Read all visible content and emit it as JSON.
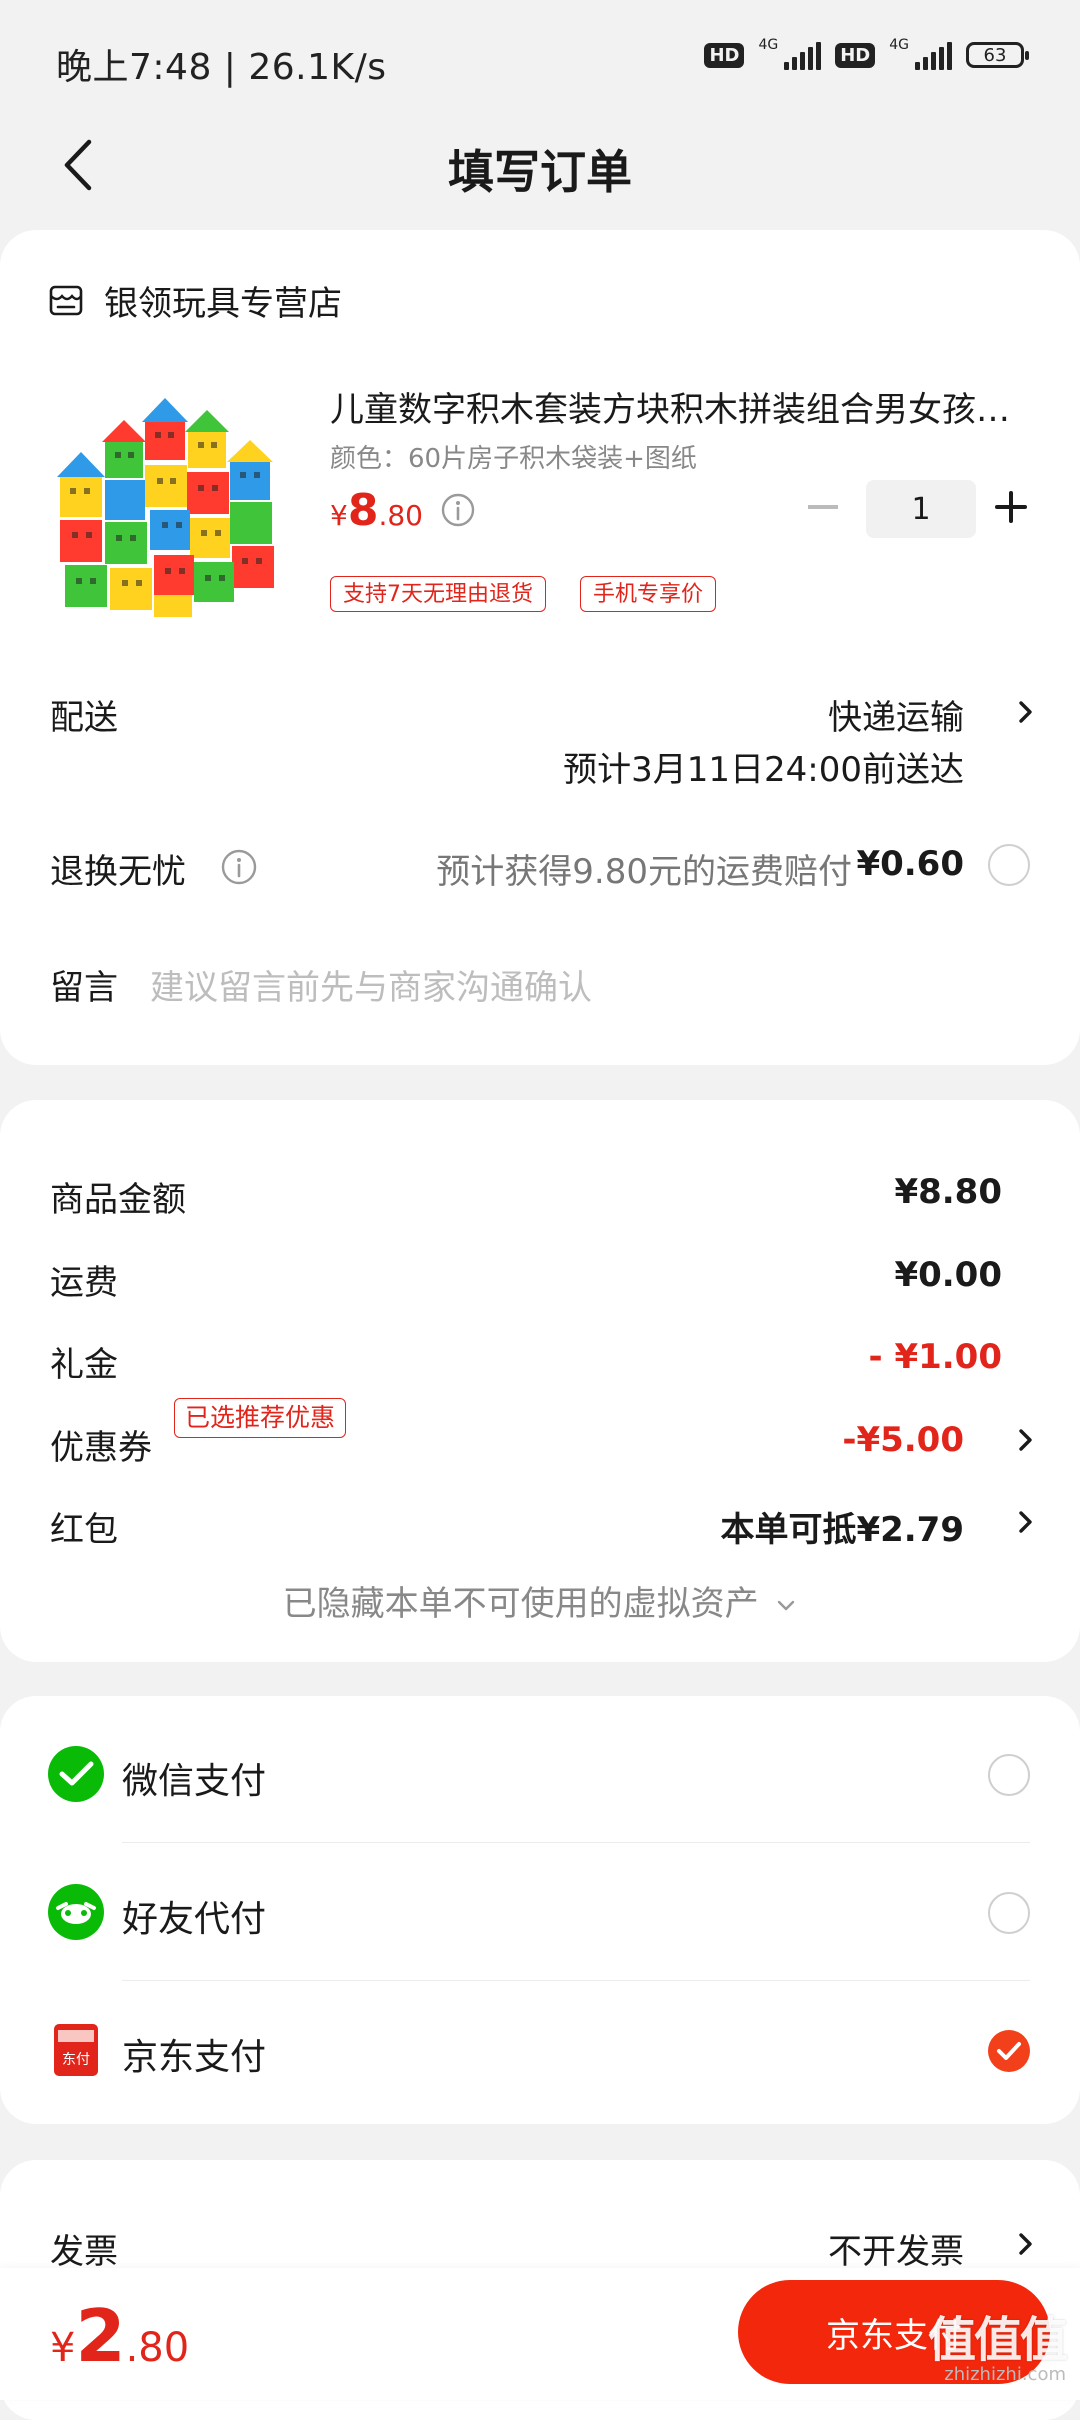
{
  "status_bar": {
    "time": "晚上7:48 | 26.1K/s",
    "battery": "63",
    "net1": "4G",
    "net2": "4G",
    "hd1": "HD",
    "hd2": "HD"
  },
  "nav": {
    "title": "填写订单"
  },
  "store": {
    "name": "银领玩具专营店"
  },
  "product": {
    "title": "儿童数字积木套装方块积木拼装组合男女孩玩具",
    "spec": "颜色：60片房子积木袋装+图纸",
    "price_symbol": "¥",
    "price_int": "8",
    "price_dec": ".80",
    "quantity": "1",
    "tags": [
      "支持7天无理由退货",
      "手机专享价"
    ]
  },
  "delivery": {
    "label": "配送",
    "method": "快递运输",
    "eta": "预计3月11日24:00前送达"
  },
  "refund": {
    "label": "退换无忧",
    "text": "预计获得9.80元的运费赔付",
    "price": "¥0.60",
    "checked": false
  },
  "message": {
    "label": "留言",
    "placeholder": "建议留言前先与商家沟通确认"
  },
  "costs": {
    "items": [
      {
        "label": "商品金额",
        "value": "¥8.80"
      },
      {
        "label": "运费",
        "value": "¥0.00"
      },
      {
        "label": "礼金",
        "value": "- ¥1.00"
      },
      {
        "label": "优惠券",
        "value": "-¥5.00",
        "tag": "已选推荐优惠"
      },
      {
        "label": "红包",
        "value": "本单可抵¥2.79"
      }
    ],
    "hidden_note": "已隐藏本单不可使用的虚拟资产"
  },
  "payment": {
    "methods": [
      {
        "label": "微信支付",
        "icon": "wechat-pay-icon",
        "selected": false
      },
      {
        "label": "好友代付",
        "icon": "friend-pay-icon",
        "selected": false
      },
      {
        "label": "京东支付",
        "icon": "jd-pay-icon",
        "selected": true
      }
    ]
  },
  "invoice": {
    "label": "发票",
    "value": "不开发票"
  },
  "bottom": {
    "total_symbol": "¥",
    "total_int": "2",
    "total_dec": ".80",
    "pay_button": "京东支付"
  },
  "watermark": {
    "logo": "值值值",
    "url": "zhizhizhi.com"
  },
  "colors": {
    "accent_red": "#e1251b",
    "button_red": "#f2270c",
    "wechat_green": "#09bb07"
  }
}
